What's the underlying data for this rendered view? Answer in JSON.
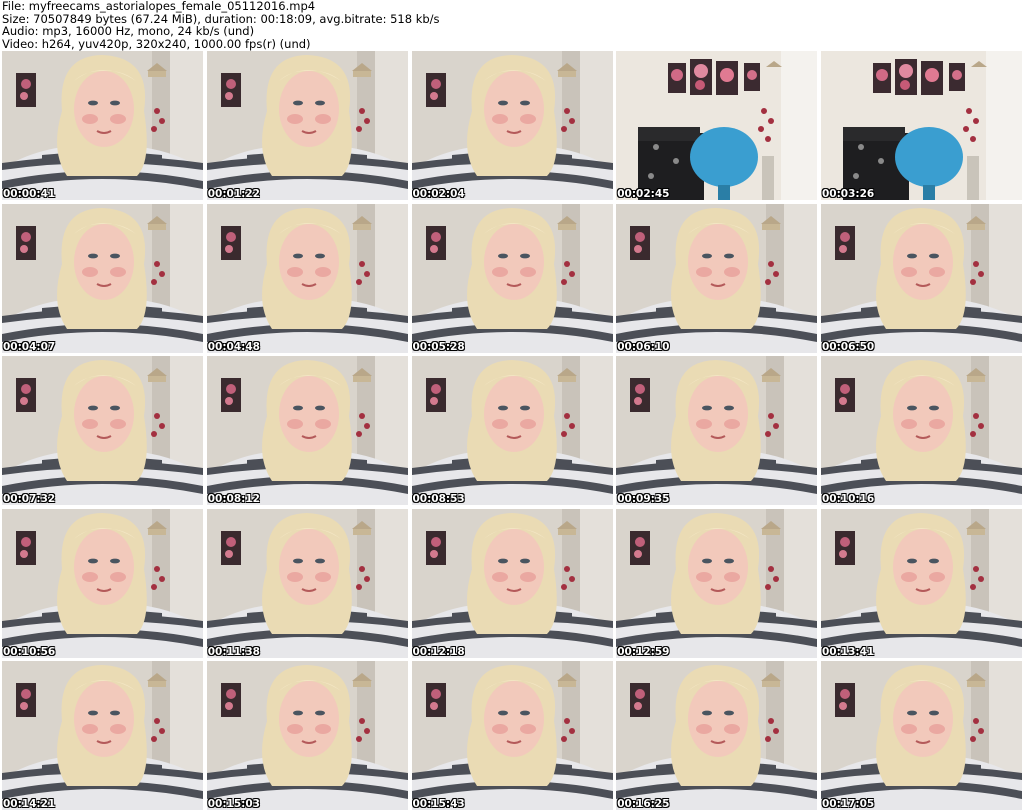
{
  "header": {
    "file_line": "File: myfreecams_astorialopes_female_05112016.mp4",
    "size_line": "Size: 70507849 bytes (67.24 MiB), duration: 00:18:09, avg.bitrate: 518 kb/s",
    "audio_line": "Audio: mp3, 16000 Hz, mono, 24 kb/s (und)",
    "video_line": "Video: h264, yuv420p, 320x240, 1000.00 fps(r) (und)"
  },
  "thumbnails": [
    {
      "timestamp": "00:00:41",
      "scene": "person"
    },
    {
      "timestamp": "00:01:22",
      "scene": "person"
    },
    {
      "timestamp": "00:02:04",
      "scene": "person"
    },
    {
      "timestamp": "00:02:45",
      "scene": "room"
    },
    {
      "timestamp": "00:03:26",
      "scene": "room"
    },
    {
      "timestamp": "00:04:07",
      "scene": "person"
    },
    {
      "timestamp": "00:04:48",
      "scene": "person"
    },
    {
      "timestamp": "00:05:28",
      "scene": "person"
    },
    {
      "timestamp": "00:06:10",
      "scene": "person"
    },
    {
      "timestamp": "00:06:50",
      "scene": "person"
    },
    {
      "timestamp": "00:07:32",
      "scene": "person"
    },
    {
      "timestamp": "00:08:12",
      "scene": "person"
    },
    {
      "timestamp": "00:08:53",
      "scene": "person"
    },
    {
      "timestamp": "00:09:35",
      "scene": "person"
    },
    {
      "timestamp": "00:10:16",
      "scene": "person"
    },
    {
      "timestamp": "00:10:56",
      "scene": "person"
    },
    {
      "timestamp": "00:11:38",
      "scene": "person"
    },
    {
      "timestamp": "00:12:18",
      "scene": "person"
    },
    {
      "timestamp": "00:12:59",
      "scene": "person"
    },
    {
      "timestamp": "00:13:41",
      "scene": "person"
    },
    {
      "timestamp": "00:14:21",
      "scene": "person"
    },
    {
      "timestamp": "00:15:03",
      "scene": "person"
    },
    {
      "timestamp": "00:15:43",
      "scene": "person"
    },
    {
      "timestamp": "00:16:25",
      "scene": "person"
    },
    {
      "timestamp": "00:17:05",
      "scene": "person"
    }
  ]
}
